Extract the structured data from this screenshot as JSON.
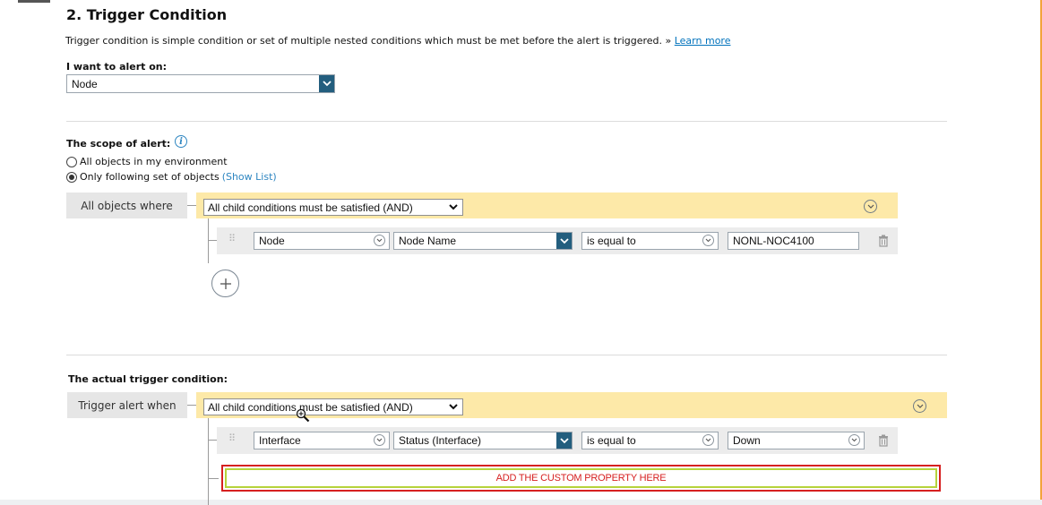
{
  "section": {
    "title": "2. Trigger Condition",
    "description": "Trigger condition is simple condition or set of multiple nested conditions which must be met before the alert is triggered. »",
    "learn_more": "Learn more"
  },
  "alert_on": {
    "label": "I want to alert on:",
    "value": "Node"
  },
  "scope": {
    "label": "The scope of alert:",
    "option_all": "All objects in my environment",
    "option_following": "Only following set of objects",
    "show_list": "(Show List)",
    "selected": "option_following",
    "where_label": "All objects where",
    "group_condition": "All child conditions must be satisfied (AND)",
    "condition": {
      "object": "Node",
      "field": "Node Name",
      "operator": "is equal to",
      "value": "NONL-NOC4100"
    }
  },
  "trigger": {
    "label": "The actual trigger condition:",
    "when_label": "Trigger alert when",
    "group_condition": "All child conditions must be satisfied (AND)",
    "condition": {
      "object": "Interface",
      "field": "Status (Interface)",
      "operator": "is equal to",
      "value": "Down"
    },
    "custom_property_note": "ADD THE CUSTOM PROPERTY HERE"
  },
  "colors": {
    "accent_dark": "#235e7e",
    "condition_bar": "#fde9a8",
    "highlight_red": "#d62020",
    "highlight_green": "#b6d33b",
    "link": "#0072bc"
  },
  "icons": {
    "info": "info-icon",
    "drag": "drag-handle-icon",
    "delete": "trash-icon",
    "add": "plus-circle-icon",
    "expand": "chevron-circle-down-icon",
    "cursor": "zoom-cursor-icon"
  }
}
